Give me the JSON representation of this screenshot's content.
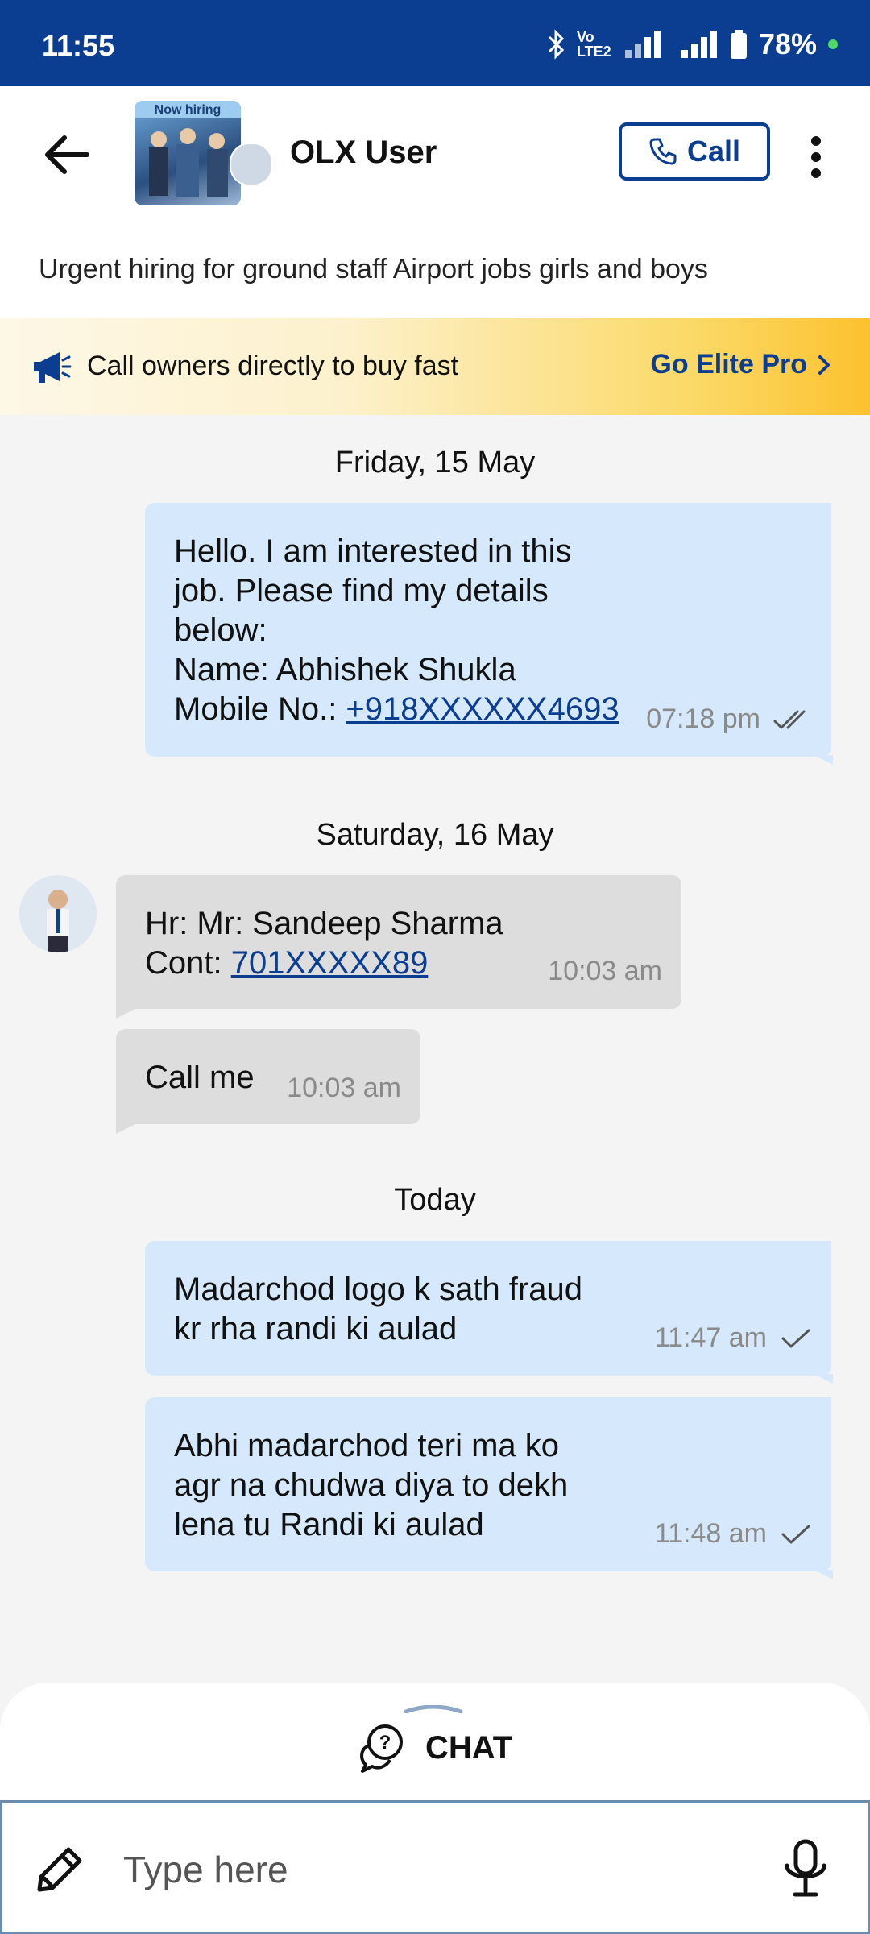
{
  "status_bar": {
    "time": "11:55",
    "battery": "78%",
    "network": "Vo LTE2"
  },
  "header": {
    "contact_name": "OLX User",
    "call_label": "Call",
    "avatar_text": "Now hiring"
  },
  "ad_title": "Urgent hiring for ground staff Airport jobs girls and boys",
  "promo": {
    "text": "Call owners directly to buy fast",
    "cta": "Go Elite Pro"
  },
  "colors": {
    "brand": "#0b3d91",
    "outgoing_bubble": "#d6e8fb",
    "incoming_bubble": "#dddddd",
    "promo_accent": "#fcc12f"
  },
  "conversation": [
    {
      "date": "Friday, 15 May"
    },
    {
      "date": "Saturday, 16 May"
    },
    {
      "date": "Today"
    }
  ],
  "messages": [
    {
      "direction": "outgoing",
      "text": "Hello. I am interested in this\njob. Please find my details\nbelow:\nName: Abhishek Shukla\nMobile No.: ",
      "link": "+918XXXXXX4693",
      "time": "07:18 pm",
      "status": "read"
    },
    {
      "direction": "incoming",
      "text": "Hr: Mr: Sandeep Sharma\nCont: ",
      "link": "701XXXXX89",
      "time": "10:03 am"
    },
    {
      "direction": "incoming",
      "text": "Call me",
      "time": "10:03 am"
    },
    {
      "direction": "outgoing",
      "text": "Madarchod logo k sath fraud\nkr rha randi ki aulad",
      "time": "11:47 am",
      "status": "sent"
    },
    {
      "direction": "outgoing",
      "text": "Abhi madarchod teri ma ko\nagr na chudwa diya to dekh\nlena tu Randi ki aulad",
      "time": "11:48 am",
      "status": "sent"
    }
  ],
  "bottom": {
    "chat_tab_label": "CHAT",
    "input_placeholder": "Type here"
  },
  "icons": [
    "back-arrow-icon",
    "phone-icon",
    "more-vertical-icon",
    "megaphone-icon",
    "chevron-right-icon",
    "double-check-icon",
    "check-icon",
    "chat-question-icon",
    "attach-icon",
    "mic-icon",
    "bluetooth-icon",
    "signal-icon",
    "battery-icon"
  ]
}
